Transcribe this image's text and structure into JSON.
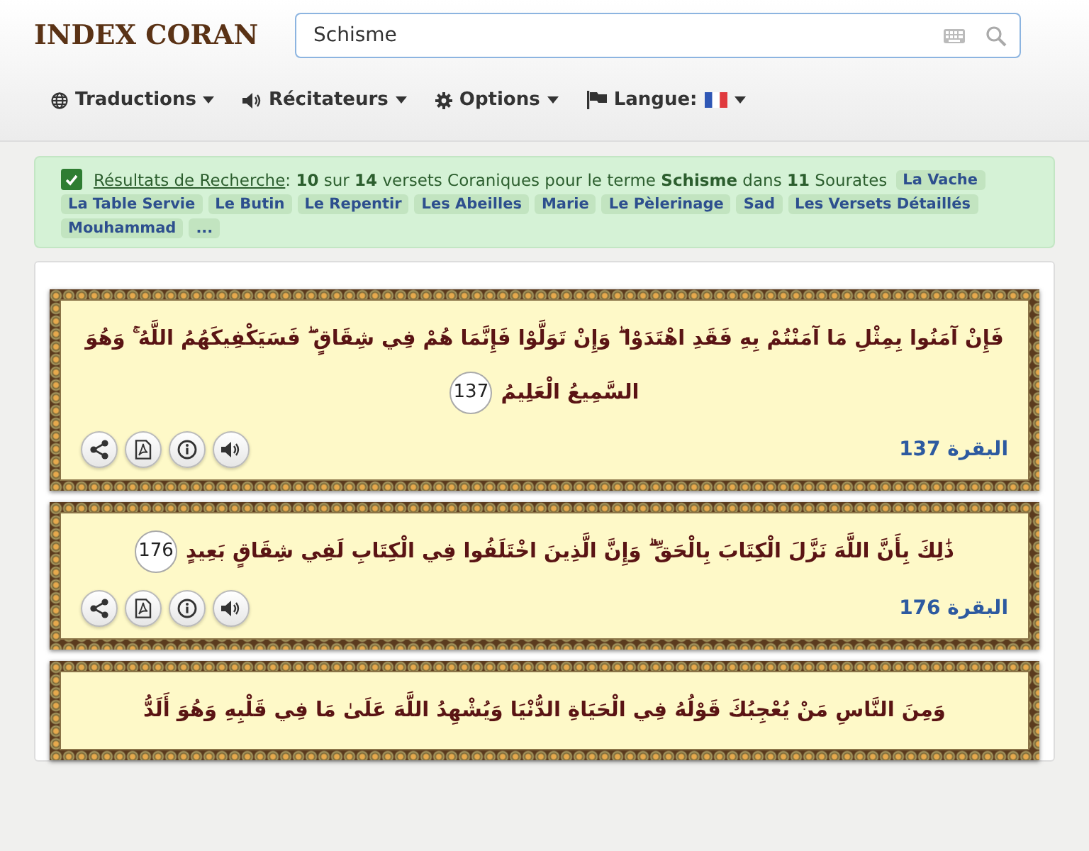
{
  "logo": {
    "text": "INDEX CORAN"
  },
  "search": {
    "value": "Schisme"
  },
  "nav": [
    {
      "kind": "globe",
      "label": "Traductions"
    },
    {
      "kind": "speaker",
      "label": "Récitateurs"
    },
    {
      "kind": "gear",
      "label": "Options"
    },
    {
      "kind": "flag",
      "label": "Langue:"
    }
  ],
  "results": {
    "checked": true,
    "link": "Résultats de Recherche",
    "summary": ": **10** sur **14** versets Coraniques pour le terme **Schisme** dans **11** Sourates",
    "tags": [
      "La Vache",
      "La Table Servie",
      "Le Butin",
      "Le Repentir",
      "Les Abeilles",
      "Marie",
      "Le Pèlerinage",
      "Sad",
      "Les Versets Détaillés",
      "Mouhammad",
      "..."
    ]
  },
  "verses": [
    {
      "text": "فَإِنْ آمَنُوا بِمِثْلِ مَا آمَنْتُمْ بِهِ فَقَدِ اهْتَدَوْا ۖ وَإِنْ تَوَلَّوْا فَإِنَّمَا هُمْ فِي شِقَاقٍ ۖ فَسَيَكْفِيكَهُمُ اللَّهُ ۚ وَهُوَ السَّمِيعُ الْعَلِيمُ",
      "number": "137",
      "reference": "البقرة 137"
    },
    {
      "text": "ذَٰلِكَ بِأَنَّ اللَّهَ نَزَّلَ الْكِتَابَ بِالْحَقِّ ۗ وَإِنَّ الَّذِينَ اخْتَلَفُوا فِي الْكِتَابِ لَفِي شِقَاقٍ بَعِيدٍ",
      "number": "176",
      "reference": "البقرة 176"
    },
    {
      "text": "وَمِنَ النَّاسِ مَنْ يُعْجِبُكَ قَوْلُهُ فِي الْحَيَاةِ الدُّنْيَا وَيُشْهِدُ اللَّهَ عَلَىٰ مَا فِي قَلْبِهِ وَهُوَ أَلَدُّ"
    }
  ]
}
